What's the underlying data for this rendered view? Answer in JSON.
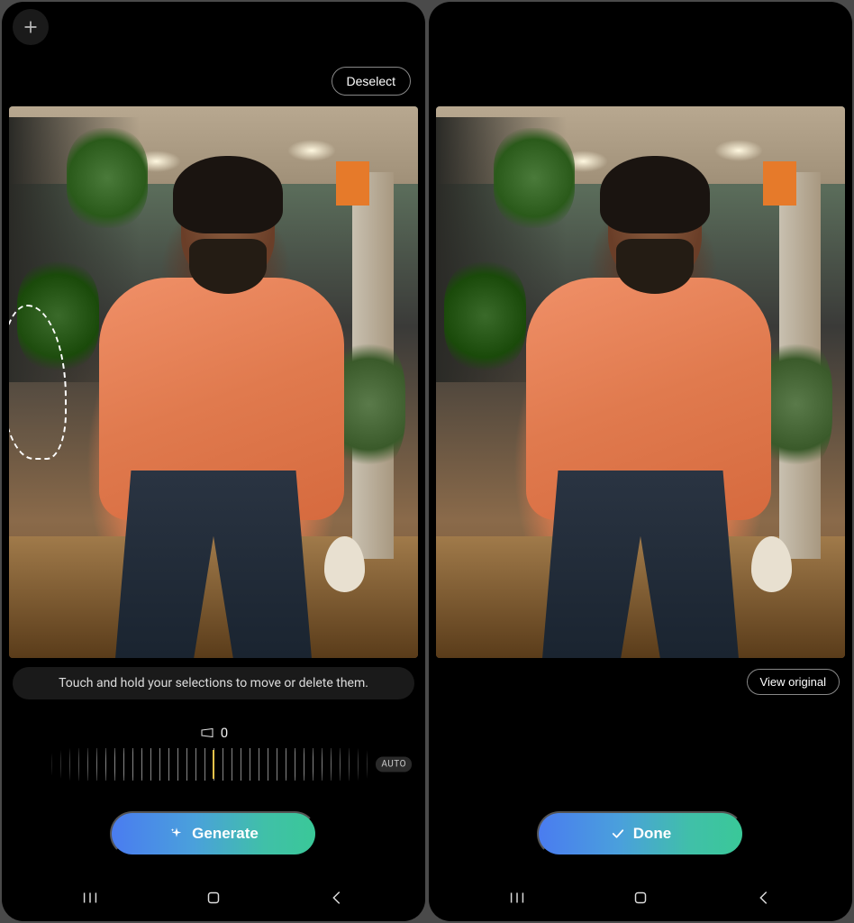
{
  "left": {
    "add_button_name": "add",
    "deselect_label": "Deselect",
    "hint": "Touch and hold your selections to move or delete them.",
    "straighten_value": "0",
    "auto_label": "AUTO",
    "cta_label": "Generate"
  },
  "right": {
    "view_original_label": "View original",
    "cta_label": "Done"
  },
  "nav": {
    "recents": "recents",
    "home": "home",
    "back": "back"
  },
  "photo": {
    "subject": "man-in-orange-sweatshirt",
    "selection_present_left": true
  }
}
